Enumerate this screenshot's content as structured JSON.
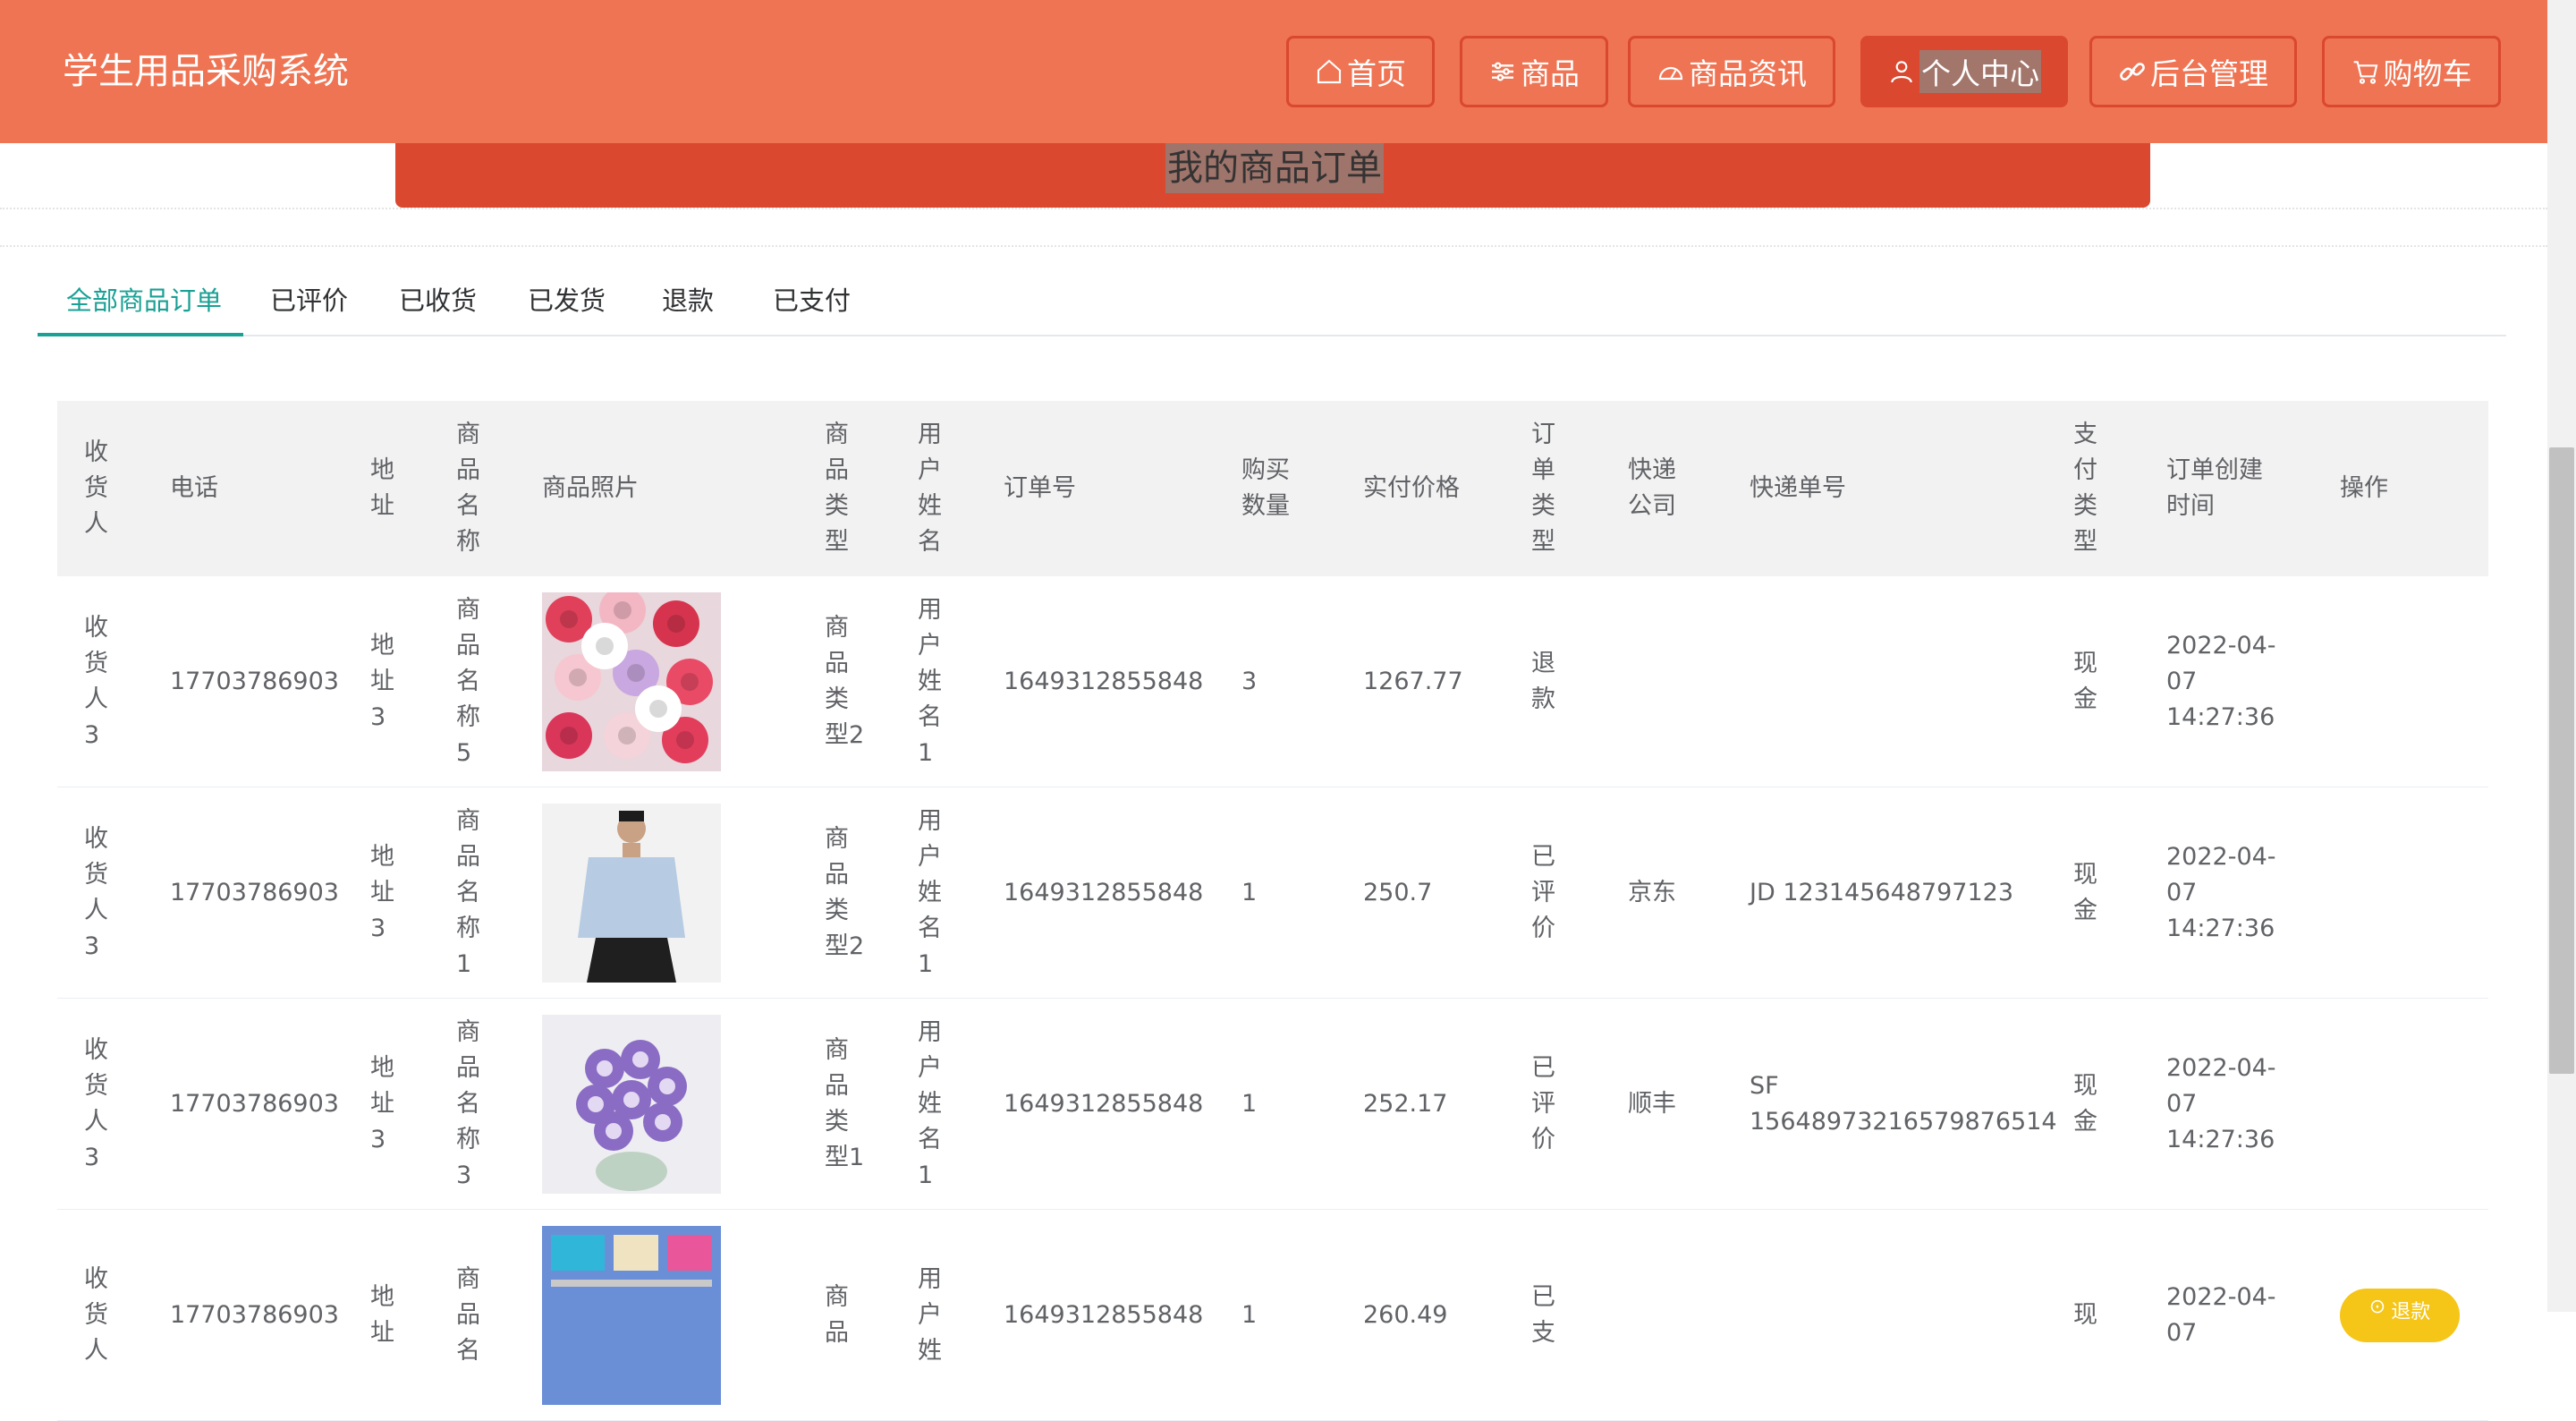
{
  "app": {
    "title": "学生用品采购系统"
  },
  "nav": [
    {
      "label": "首页",
      "icon": "home-icon"
    },
    {
      "label": "商品",
      "icon": "sliders-icon"
    },
    {
      "label": "商品资讯",
      "icon": "gauge-icon"
    },
    {
      "label": "个人中心",
      "icon": "user-icon",
      "active": true
    },
    {
      "label": "后台管理",
      "icon": "link-icon"
    },
    {
      "label": "购物车",
      "icon": "cart-icon"
    }
  ],
  "banner": {
    "title": "我的商品订单"
  },
  "tabs": [
    "全部商品订单",
    "已评价",
    "已收货",
    "已发货",
    "退款",
    "已支付"
  ],
  "table": {
    "headers": [
      "收\n货\n人",
      "电话",
      "地\n址",
      "商\n品\n名\n称",
      "商品照片",
      "商\n品\n类\n型",
      "用\n户\n姓\n名",
      "订单号",
      "购买\n数量",
      "实付价格",
      "订\n单\n类\n型",
      "快递\n公司",
      "快递单号",
      "支\n付\n类\n型",
      "订单创建\n时间",
      "操作"
    ],
    "rows": [
      [
        "收\n货\n人\n3",
        "17703786903",
        "地\n址\n3",
        "商\n品\n名\n称\n5",
        "",
        "商\n品\n类\n型2",
        "用\n户\n姓\n名\n1",
        "1649312855848",
        "3",
        "1267.77",
        "退\n款",
        "",
        "",
        "现\n金",
        "2022-04-\n07\n14:27:36",
        ""
      ],
      [
        "收\n货\n人\n3",
        "17703786903",
        "地\n址\n3",
        "商\n品\n名\n称\n1",
        "",
        "商\n品\n类\n型2",
        "用\n户\n姓\n名\n1",
        "1649312855848",
        "1",
        "250.7",
        "已\n评\n价",
        "京东",
        "JD 123145648797123",
        "现\n金",
        "2022-04-\n07\n14:27:36",
        ""
      ],
      [
        "收\n货\n人\n3",
        "17703786903",
        "地\n址\n3",
        "商\n品\n名\n称\n3",
        "",
        "商\n品\n类\n型1",
        "用\n户\n姓\n名\n1",
        "1649312855848",
        "1",
        "252.17",
        "已\n评\n价",
        "顺丰",
        "SF\n15648973216579876514",
        "现\n金",
        "2022-04-\n07\n14:27:36",
        ""
      ],
      [
        "收\n货\n人",
        "17703786903",
        "地\n址",
        "商\n品\n名",
        "",
        "商\n品",
        "用\n户\n姓",
        "1649312855848",
        "1",
        "260.49",
        "已\n支",
        "",
        "",
        "现",
        "2022-04-\n07",
        ""
      ]
    ]
  },
  "float_button": {
    "label": "退款"
  },
  "colors": {
    "header": "#ef7453",
    "accent": "#d9482f",
    "tab_active": "#1aa094"
  }
}
